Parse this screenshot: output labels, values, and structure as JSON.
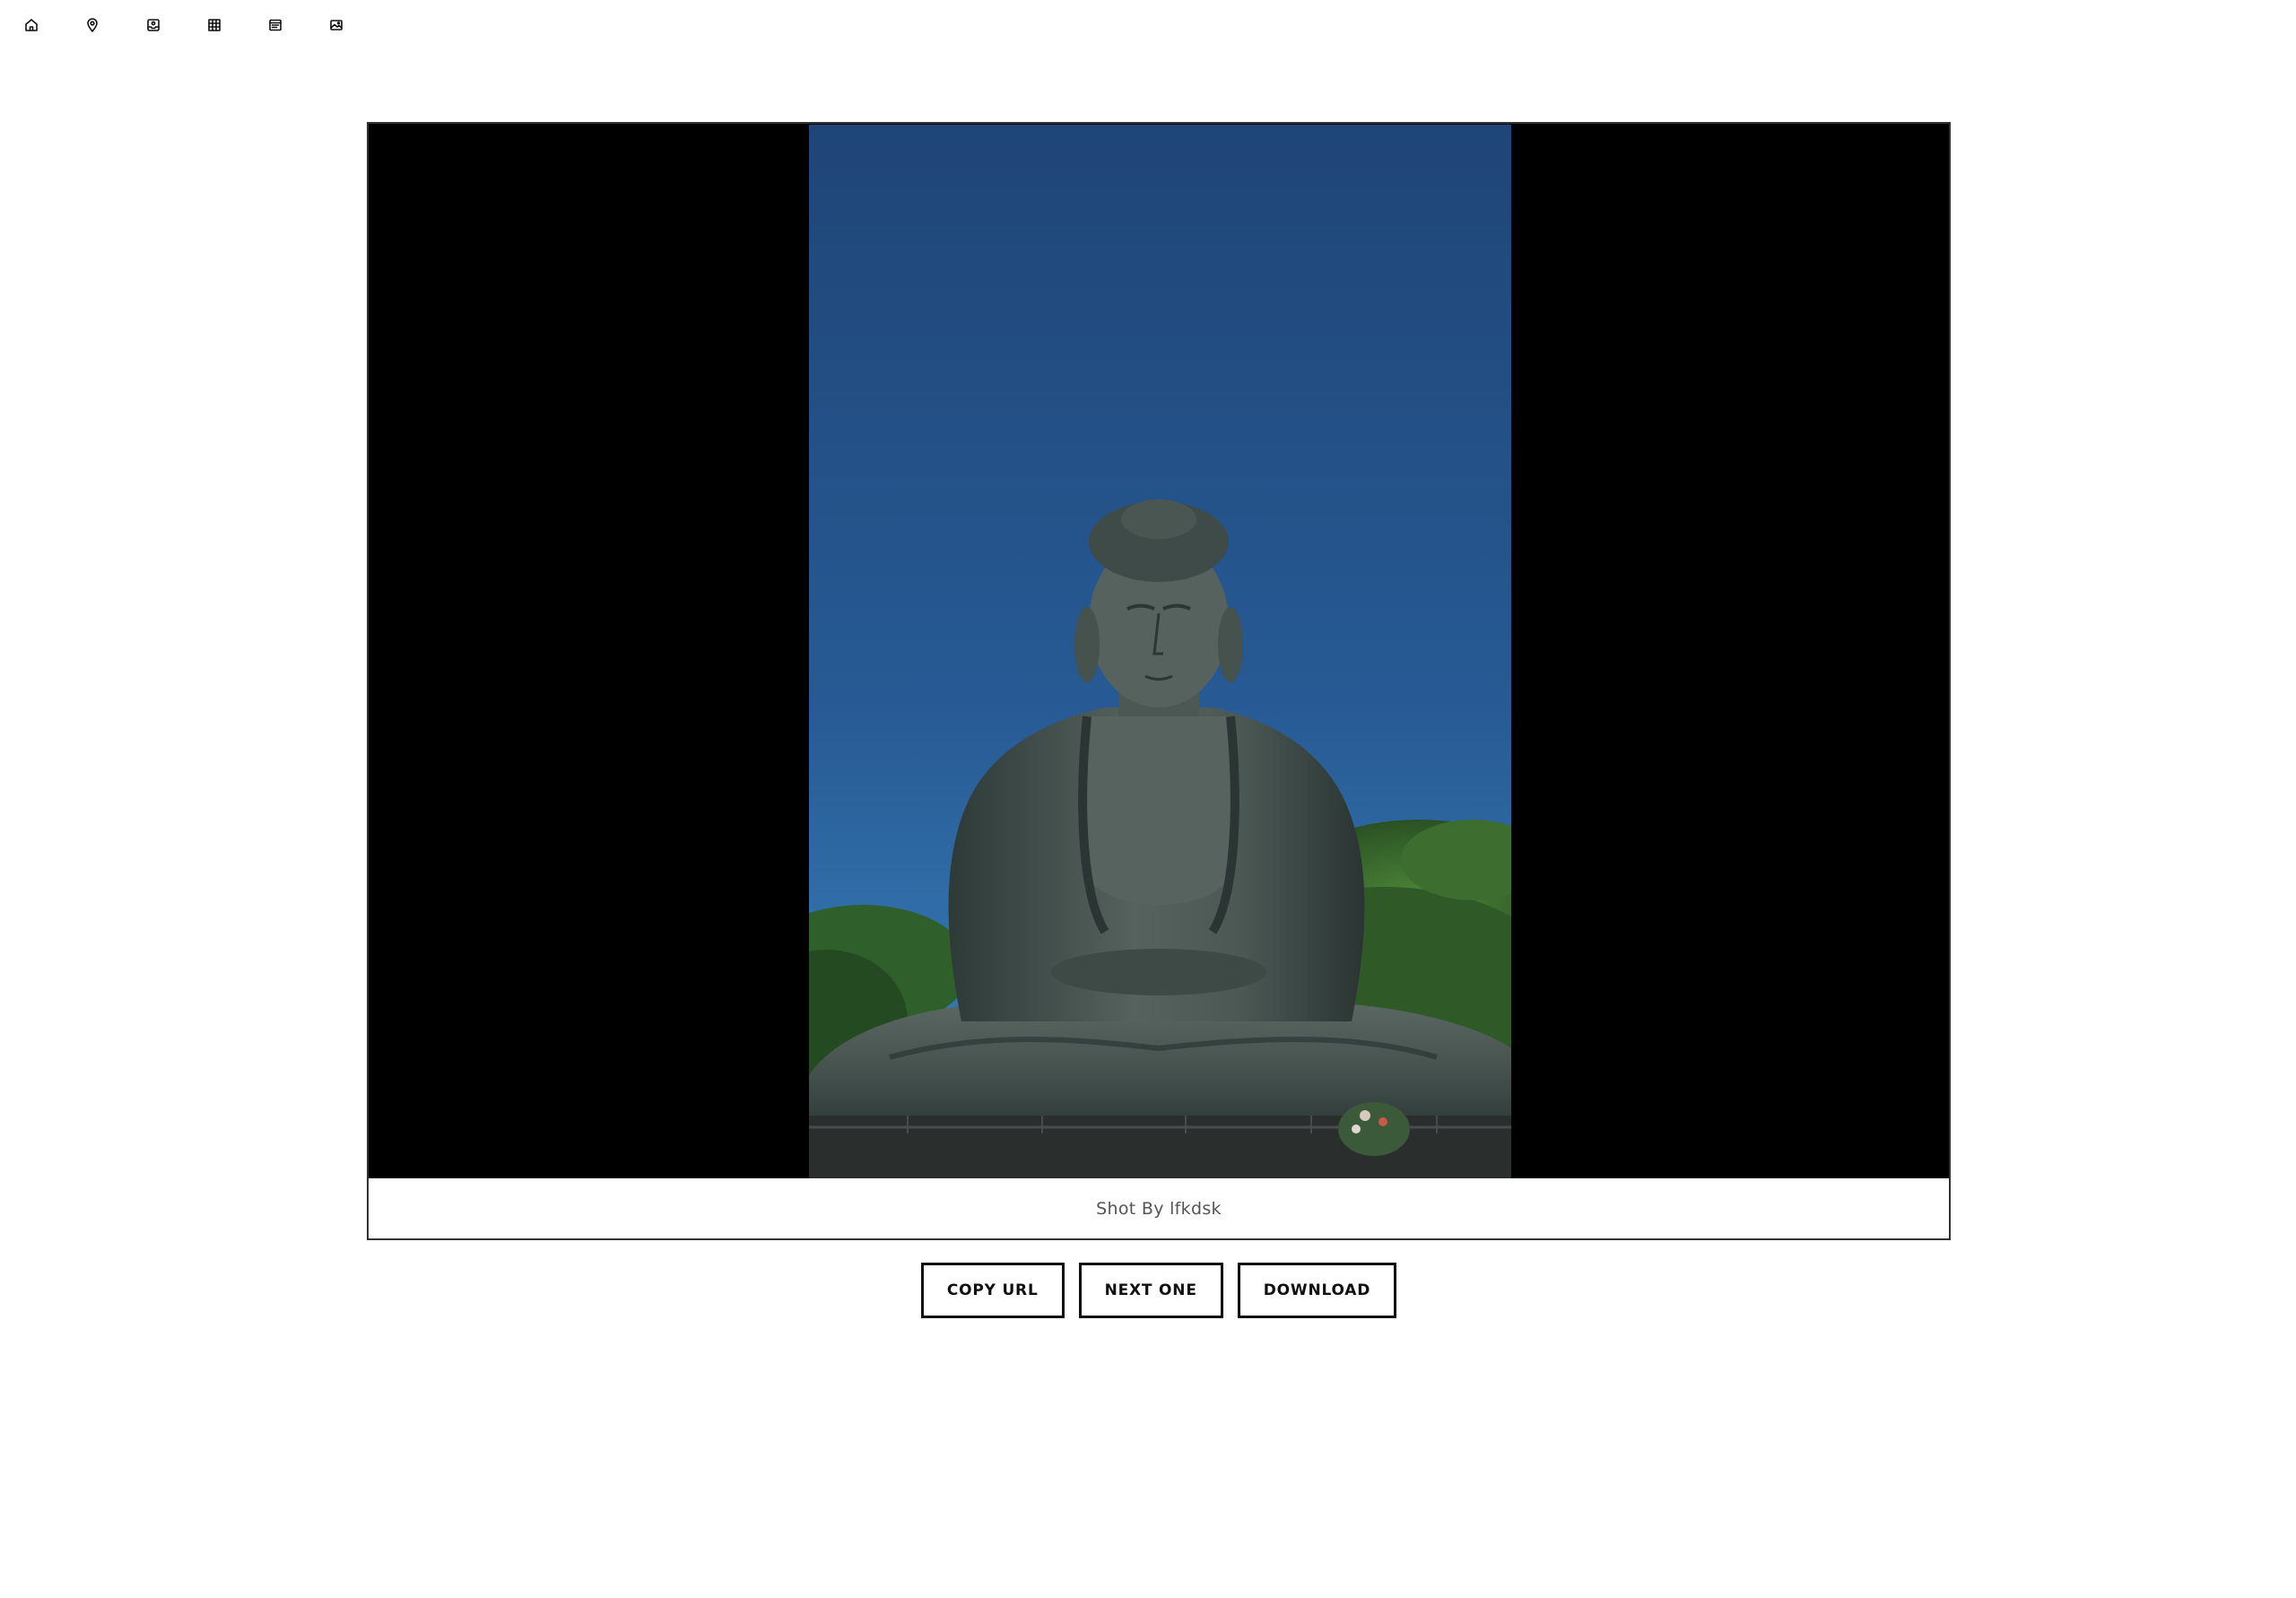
{
  "toolbar": {
    "icons": [
      "home-icon",
      "map-pin-icon",
      "inbox-photo-icon",
      "grid-icon",
      "list-card-icon",
      "image-icon"
    ]
  },
  "viewer": {
    "caption": "Shot By lfkdsk",
    "background_color": "#000000"
  },
  "actions": {
    "copy_url_label": "COPY URL",
    "next_one_label": "NEXT ONE",
    "download_label": "DOWNLOAD"
  }
}
